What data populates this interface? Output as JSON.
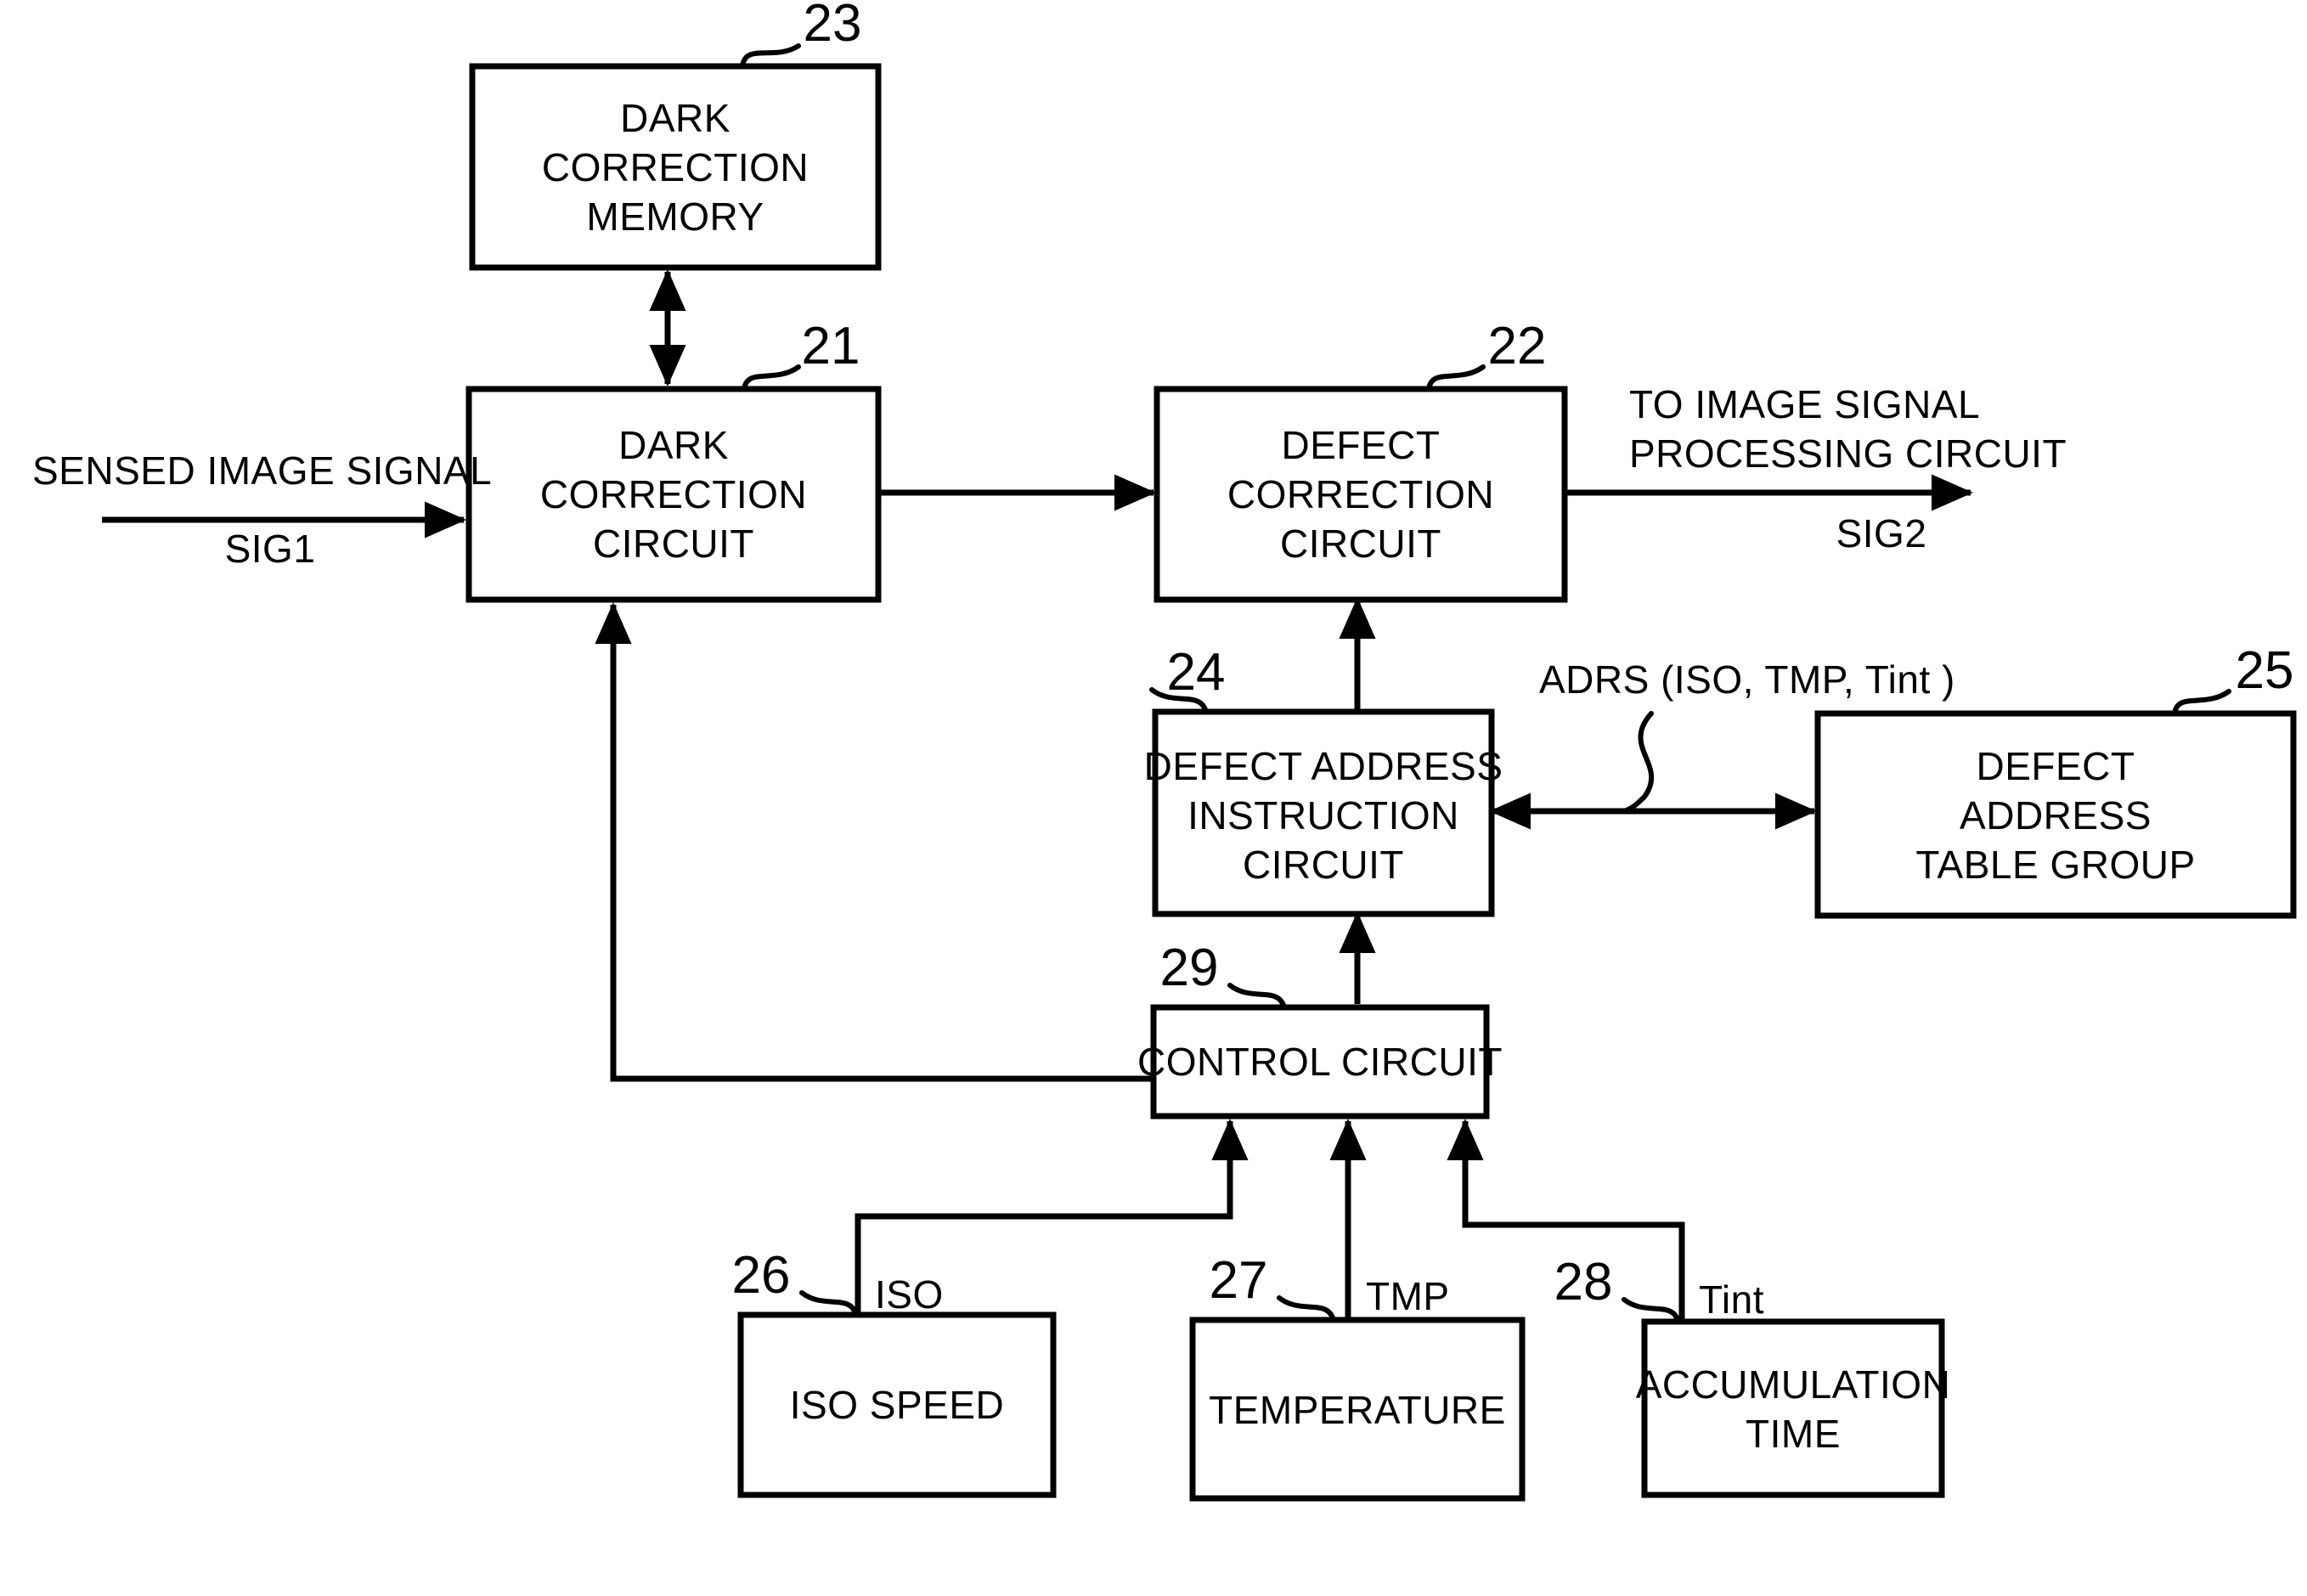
{
  "figure": {
    "type": "block-diagram",
    "boxes": [
      {
        "ref": "23",
        "lines": [
          "DARK",
          "CORRECTION",
          "MEMORY"
        ]
      },
      {
        "ref": "21",
        "lines": [
          "DARK",
          "CORRECTION",
          "CIRCUIT"
        ]
      },
      {
        "ref": "22",
        "lines": [
          "DEFECT",
          "CORRECTION",
          "CIRCUIT"
        ]
      },
      {
        "ref": "24",
        "lines": [
          "DEFECT ADDRESS",
          "INSTRUCTION",
          "CIRCUIT"
        ]
      },
      {
        "ref": "25",
        "lines": [
          "DEFECT",
          "ADDRESS",
          "TABLE GROUP"
        ]
      },
      {
        "ref": "29",
        "lines": [
          "CONTROL CIRCUIT"
        ]
      },
      {
        "ref": "26",
        "lines": [
          "ISO SPEED"
        ]
      },
      {
        "ref": "27",
        "lines": [
          "TEMPERATURE"
        ]
      },
      {
        "ref": "28",
        "lines": [
          "ACCUMULATION",
          "TIME"
        ]
      }
    ],
    "signals": {
      "input_name": "SENSED IMAGE SIGNAL",
      "input_id": "SIG1",
      "output_name_line1": "TO IMAGE SIGNAL",
      "output_name_line2": "PROCESSING CIRCUIT",
      "output_id": "SIG2",
      "address_bus": "ADRS (ISO, TMP, Tint )",
      "iso": "ISO",
      "tmp": "TMP",
      "tint": "Tint"
    },
    "colors": {
      "line": "#000000",
      "background": "#ffffff",
      "text": "#000000"
    }
  }
}
